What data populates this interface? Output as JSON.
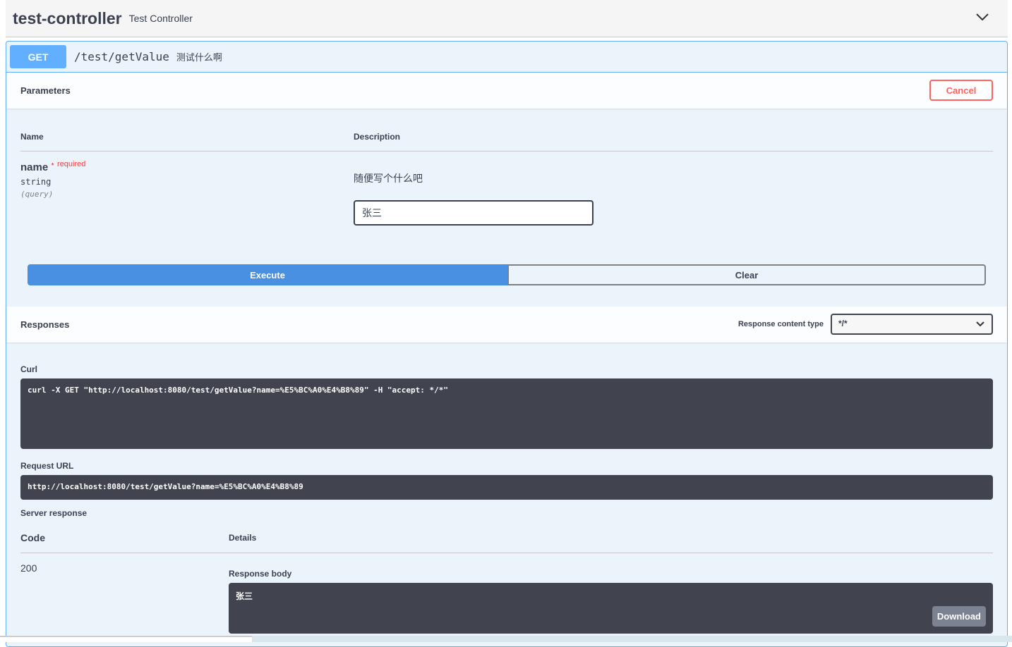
{
  "tag": {
    "name": "test-controller",
    "description": "Test Controller"
  },
  "operation": {
    "method": "GET",
    "path": "/test/getValue",
    "summary": "测试什么啊"
  },
  "parameters": {
    "title": "Parameters",
    "cancel": "Cancel",
    "col_name": "Name",
    "col_description": "Description",
    "param": {
      "name": "name",
      "required_star": "*",
      "required": "required",
      "type": "string",
      "in": "(query)",
      "description": "随便写个什么吧",
      "value": "张三"
    }
  },
  "actions": {
    "execute": "Execute",
    "clear": "Clear"
  },
  "responses": {
    "title": "Responses",
    "content_type_label": "Response content type",
    "content_type": "*/*",
    "curl_label": "Curl",
    "curl": "curl -X GET \"http://localhost:8080/test/getValue?name=%E5%BC%A0%E4%B8%89\" -H \"accept: */*\"",
    "request_url_label": "Request URL",
    "request_url": "http://localhost:8080/test/getValue?name=%E5%BC%A0%E4%B8%89",
    "server_response_label": "Server response",
    "col_code": "Code",
    "col_details": "Details",
    "code": "200",
    "body_label": "Response body",
    "body": "张三",
    "download": "Download"
  }
}
